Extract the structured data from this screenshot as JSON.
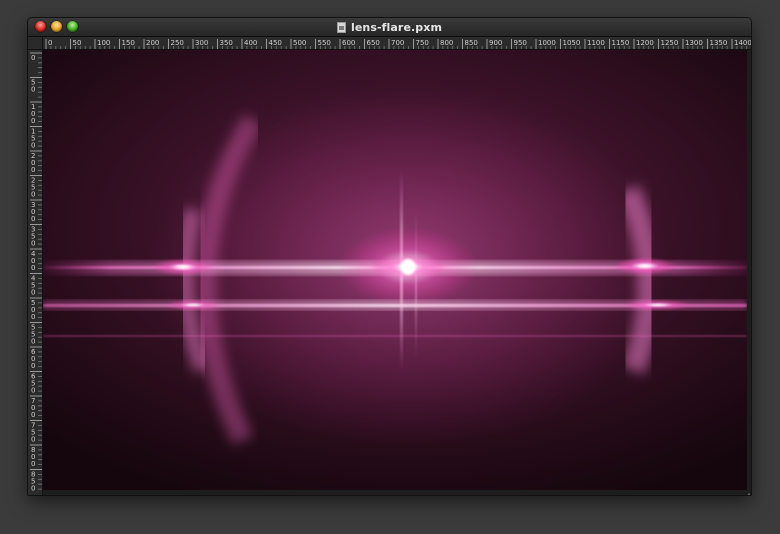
{
  "window": {
    "title": "lens-flare.pxm",
    "controls": {
      "close_icon": "close-traffic-light",
      "minimize_icon": "minimize-traffic-light",
      "zoom_icon": "zoom-traffic-light"
    }
  },
  "rulers": {
    "horizontal_labels": [
      "0",
      "50",
      "100",
      "150",
      "200",
      "250",
      "300",
      "350",
      "400",
      "450",
      "500",
      "550",
      "600",
      "650",
      "700",
      "750",
      "800",
      "850",
      "900",
      "950",
      "1000",
      "1050",
      "1100",
      "1150",
      "1200",
      "1250",
      "1300",
      "1350",
      "1400"
    ],
    "vertical_labels": [
      "0",
      "50",
      "100",
      "150",
      "200",
      "250",
      "300",
      "350",
      "400",
      "450",
      "500",
      "550",
      "600",
      "650",
      "700",
      "750",
      "800",
      "850"
    ]
  },
  "canvas": {
    "image_description_colors": {
      "background_dark": "#1a0810",
      "glow_pink": "#ff66cc",
      "core_white": "#ffffff"
    }
  }
}
